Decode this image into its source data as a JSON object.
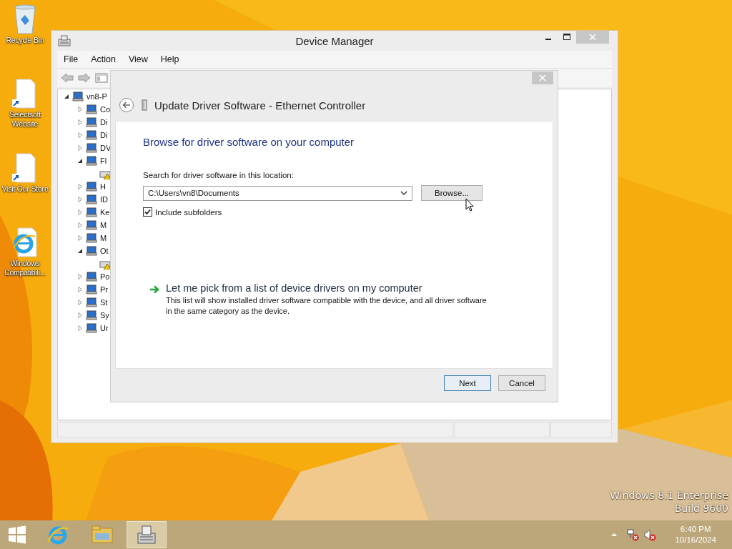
{
  "desktop_icons": [
    {
      "label": "Recycle Bin",
      "kind": "bin"
    },
    {
      "label": "Selectsoft Website",
      "kind": "shortcut"
    },
    {
      "label": "Visit Our Store",
      "kind": "shortcut"
    },
    {
      "label": "Windows Compatibili...",
      "kind": "ie"
    }
  ],
  "device_manager": {
    "title": "Device Manager",
    "menu": [
      "File",
      "Action",
      "View",
      "Help"
    ],
    "tree": {
      "label": "vn8-P",
      "expanded": true,
      "children": [
        {
          "label": "Co",
          "expanded": false
        },
        {
          "label": "Di",
          "expanded": false
        },
        {
          "label": "Di",
          "expanded": false
        },
        {
          "label": "DV",
          "expanded": false
        },
        {
          "label": "Fl",
          "expanded": true,
          "children": [
            {
              "warning": true
            }
          ]
        },
        {
          "label": "H",
          "expanded": false
        },
        {
          "label": "ID",
          "expanded": false
        },
        {
          "label": "Ke",
          "expanded": false
        },
        {
          "label": "M",
          "expanded": false
        },
        {
          "label": "M",
          "expanded": false
        },
        {
          "label": "Ot",
          "expanded": true,
          "children": [
            {
              "warning": true
            }
          ]
        },
        {
          "label": "Po",
          "expanded": false
        },
        {
          "label": "Pr",
          "expanded": false
        },
        {
          "label": "St",
          "expanded": false
        },
        {
          "label": "Sy",
          "expanded": false
        },
        {
          "label": "Ur",
          "expanded": false
        }
      ]
    }
  },
  "dialog": {
    "title": "Update Driver Software - Ethernet Controller",
    "heading": "Browse for driver software on your computer",
    "search_label": "Search for driver software in this location:",
    "path": "C:\\Users\\vn8\\Documents",
    "browse": "Browse...",
    "include_subfolders": {
      "label": "Include subfolders",
      "checked": true
    },
    "option": {
      "title": "Let me pick from a list of device drivers on my computer",
      "description": "This list will show installed driver software compatible with the device, and all driver software in the same category as the device."
    },
    "buttons": [
      {
        "label": "Next",
        "default": true
      },
      {
        "label": "Cancel",
        "default": false
      }
    ]
  },
  "watermark": [
    "Windows 8.1 Enterprise",
    "Build 9600"
  ],
  "taskbar": {
    "apps": [
      {
        "kind": "ie",
        "selected": false
      },
      {
        "kind": "explorer",
        "selected": false
      },
      {
        "kind": "devmgr",
        "selected": true
      }
    ],
    "time": "6:40 PM",
    "date": "10/16/2024"
  }
}
